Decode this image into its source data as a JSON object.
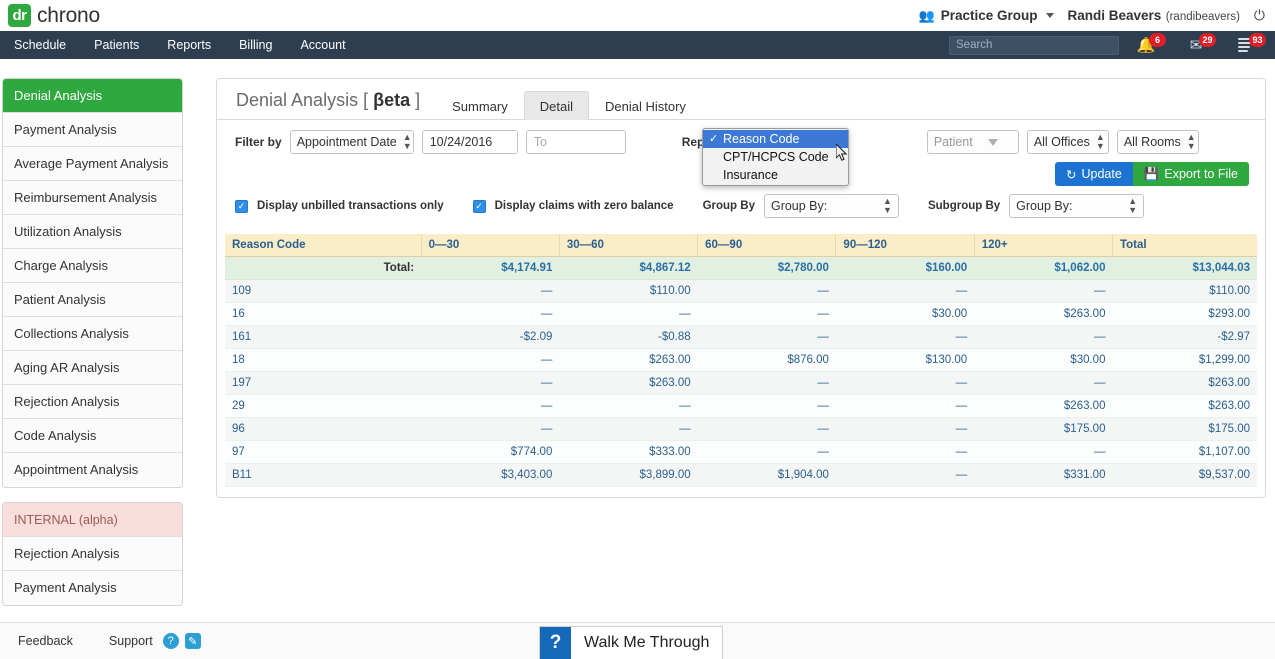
{
  "brand": {
    "logo_mark": "dr",
    "logo_text": "chrono",
    "practice_group": "Practice Group",
    "practice_group_icon": "people-icon",
    "user_name": "Randi Beavers",
    "user_handle": "(randibeavers)",
    "power_icon": "power-icon"
  },
  "nav": {
    "items": [
      {
        "label": "Schedule"
      },
      {
        "label": "Patients"
      },
      {
        "label": "Reports"
      },
      {
        "label": "Billing"
      },
      {
        "label": "Account"
      }
    ],
    "search_placeholder": "Search",
    "badges": [
      {
        "icon": "alert-icon",
        "count": "6"
      },
      {
        "icon": "envelope-icon",
        "count": "29"
      },
      {
        "icon": "menu-icon",
        "count": "93"
      }
    ]
  },
  "sidebar": {
    "primary": [
      {
        "label": "Denial Analysis",
        "active": true
      },
      {
        "label": "Payment Analysis",
        "active": false
      },
      {
        "label": "Average Payment Analysis",
        "active": false
      },
      {
        "label": "Reimbursement Analysis",
        "active": false
      },
      {
        "label": "Utilization Analysis",
        "active": false
      },
      {
        "label": "Charge Analysis",
        "active": false
      },
      {
        "label": "Patient Analysis",
        "active": false
      },
      {
        "label": "Collections Analysis",
        "active": false
      },
      {
        "label": "Aging AR Analysis",
        "active": false
      },
      {
        "label": "Rejection Analysis",
        "active": false
      },
      {
        "label": "Code Analysis",
        "active": false
      },
      {
        "label": "Appointment Analysis",
        "active": false
      }
    ],
    "internal_header": "INTERNAL (alpha)",
    "internal": [
      {
        "label": "Rejection Analysis"
      },
      {
        "label": "Payment Analysis"
      }
    ]
  },
  "panel": {
    "title_main": "Denial Analysis [ ",
    "title_beta": "βeta",
    "title_tail": " ]",
    "tabs": [
      {
        "label": "Summary",
        "active": false
      },
      {
        "label": "Detail",
        "active": true
      },
      {
        "label": "Denial History",
        "active": false
      }
    ]
  },
  "filters": {
    "filter_by_label": "Filter by",
    "filter_by_value": "Appointment Date",
    "date_from_value": "10/24/2016",
    "date_to_placeholder": "To",
    "report_type_label": "Report Type",
    "report_type_options": [
      {
        "label": "Reason Code",
        "selected": true,
        "check": "✓"
      },
      {
        "label": "CPT/HCPCS Code",
        "selected": false,
        "check": ""
      },
      {
        "label": "Insurance",
        "selected": false,
        "check": ""
      }
    ],
    "patient_placeholder": "Patient",
    "offices_value": "All Offices",
    "rooms_value": "All Rooms",
    "update_label": "Update",
    "update_icon": "refresh-icon",
    "export_label": "Export to File",
    "export_icon": "save-icon",
    "checkbox_unbilled_label": "Display unbilled transactions only",
    "checkbox_unbilled_checked": true,
    "checkbox_zero_label": "Display claims with zero balance",
    "checkbox_zero_checked": true,
    "group_by_label": "Group By",
    "group_by_value": "Group By:",
    "subgroup_by_label": "Subgroup By",
    "subgroup_by_value": "Group By:"
  },
  "colors": {
    "brand_green": "#2fa83f",
    "navbar": "#2c3e50",
    "badge_red": "#dd1f26",
    "update_blue": "#1c73d2",
    "table_header": "#fbedc7",
    "total_row": "#e2f0e2",
    "dropdown_highlight": "#3c79d6",
    "link_blue": "#2a5f8f"
  },
  "table": {
    "columns": [
      "Reason Code",
      "0—30",
      "30—60",
      "60—90",
      "90—120",
      "120+",
      "Total"
    ],
    "total_row": {
      "label": "Total:",
      "values": [
        "$4,174.91",
        "$4,867.12",
        "$2,780.00",
        "$160.00",
        "$1,062.00",
        "$13,044.03"
      ]
    },
    "rows": [
      {
        "code": "109",
        "values": [
          "—",
          "$110.00",
          "—",
          "—",
          "—",
          "$110.00"
        ]
      },
      {
        "code": "16",
        "values": [
          "—",
          "—",
          "—",
          "$30.00",
          "$263.00",
          "$293.00"
        ]
      },
      {
        "code": "161",
        "values": [
          "-$2.09",
          "-$0.88",
          "—",
          "—",
          "—",
          "-$2.97"
        ]
      },
      {
        "code": "18",
        "values": [
          "—",
          "$263.00",
          "$876.00",
          "$130.00",
          "$30.00",
          "$1,299.00"
        ]
      },
      {
        "code": "197",
        "values": [
          "—",
          "$263.00",
          "—",
          "—",
          "—",
          "$263.00"
        ]
      },
      {
        "code": "29",
        "values": [
          "—",
          "—",
          "—",
          "—",
          "$263.00",
          "$263.00"
        ]
      },
      {
        "code": "96",
        "values": [
          "—",
          "—",
          "—",
          "—",
          "$175.00",
          "$175.00"
        ]
      },
      {
        "code": "97",
        "values": [
          "$774.00",
          "$333.00",
          "—",
          "—",
          "—",
          "$1,107.00"
        ]
      },
      {
        "code": "B11",
        "values": [
          "$3,403.00",
          "$3,899.00",
          "$1,904.00",
          "—",
          "$331.00",
          "$9,537.00"
        ]
      }
    ]
  },
  "footer": {
    "feedback_label": "Feedback",
    "support_label": "Support",
    "help_icon": "question-circle-icon",
    "edit_icon": "pencil-icon",
    "walkme_q": "?",
    "walkme_label": "Walk Me Through"
  }
}
